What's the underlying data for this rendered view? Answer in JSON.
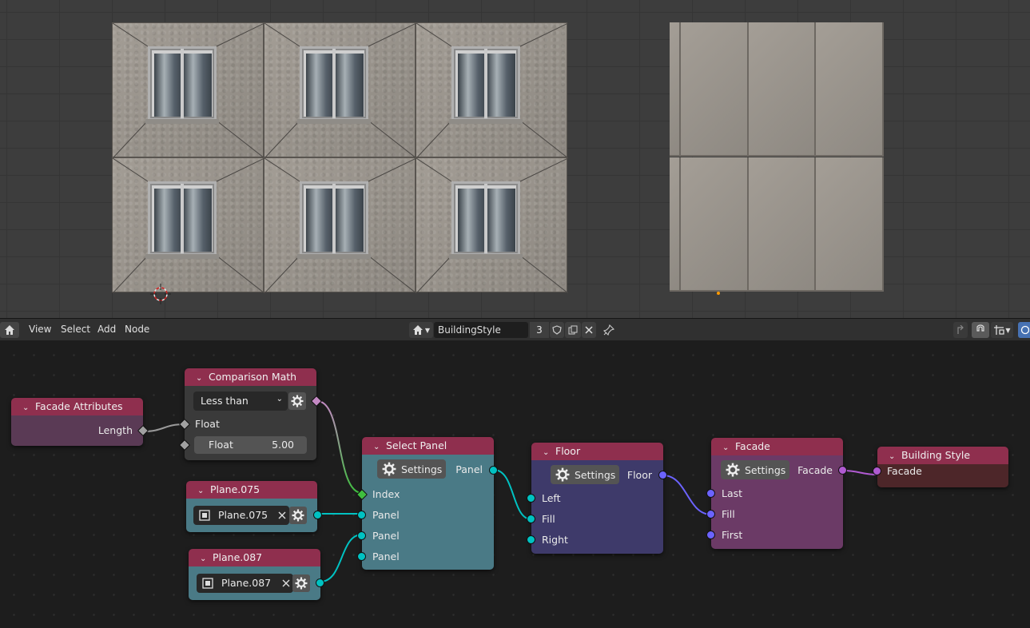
{
  "header": {
    "menu": [
      "View",
      "Select",
      "Add",
      "Node"
    ],
    "tree_name": "BuildingStyle",
    "user_count": "3"
  },
  "nodes": {
    "facade_attributes": {
      "title": "Facade Attributes",
      "output_length": "Length"
    },
    "comparison_math": {
      "title": "Comparison Math",
      "operation": "Less than",
      "input_a": "Float",
      "input_b_label": "Float",
      "input_b_value": "5.00"
    },
    "plane075": {
      "title": "Plane.075",
      "object": "Plane.075"
    },
    "plane087": {
      "title": "Plane.087",
      "object": "Plane.087"
    },
    "select_panel": {
      "title": "Select Panel",
      "settings": "Settings",
      "output": "Panel",
      "inputs": [
        "Index",
        "Panel",
        "Panel",
        "Panel"
      ]
    },
    "floor": {
      "title": "Floor",
      "settings": "Settings",
      "output": "Floor",
      "inputs": [
        "Left",
        "Fill",
        "Right"
      ]
    },
    "facade": {
      "title": "Facade",
      "settings": "Settings",
      "output": "Facade",
      "inputs": [
        "Last",
        "Fill",
        "First"
      ]
    },
    "building_style": {
      "title": "Building Style",
      "input": "Facade"
    }
  },
  "colors": {
    "node_header": "#8f2f4e",
    "facade_attributes_body": "#5a3a55",
    "comparison_body": "#3a3a3a",
    "object_body": "#4a7a86",
    "select_panel_body": "#4a7a86",
    "floor_body": "#3e3a6a",
    "facade_body": "#6b3a66",
    "building_style_body": "#4d2629"
  }
}
